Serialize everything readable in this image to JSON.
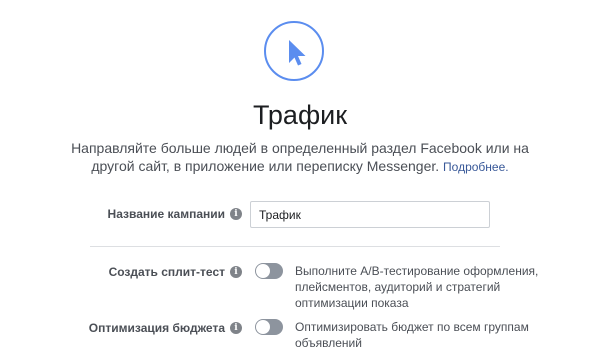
{
  "objective": {
    "icon": "cursor-icon",
    "title": "Трафик",
    "description": "Направляйте больше людей в определенный раздел Facebook или на другой сайт, в приложение или переписку Messenger.",
    "learn_more": "Подробнее."
  },
  "campaign_name": {
    "label": "Название кампании",
    "value": "Трафик"
  },
  "split_test": {
    "label": "Создать сплит-тест",
    "enabled": false,
    "description": "Выполните A/B-тестирование оформления, плейсментов, аудиторий и стратегий оптимизации показа"
  },
  "budget_optimization": {
    "label": "Оптимизация бюджета",
    "enabled": false,
    "description": "Оптимизировать бюджет по всем группам объявлений"
  },
  "colors": {
    "accent": "#5b8def",
    "link": "#385898",
    "toggle_off": "#8d949e",
    "text": "#4b4f56"
  }
}
